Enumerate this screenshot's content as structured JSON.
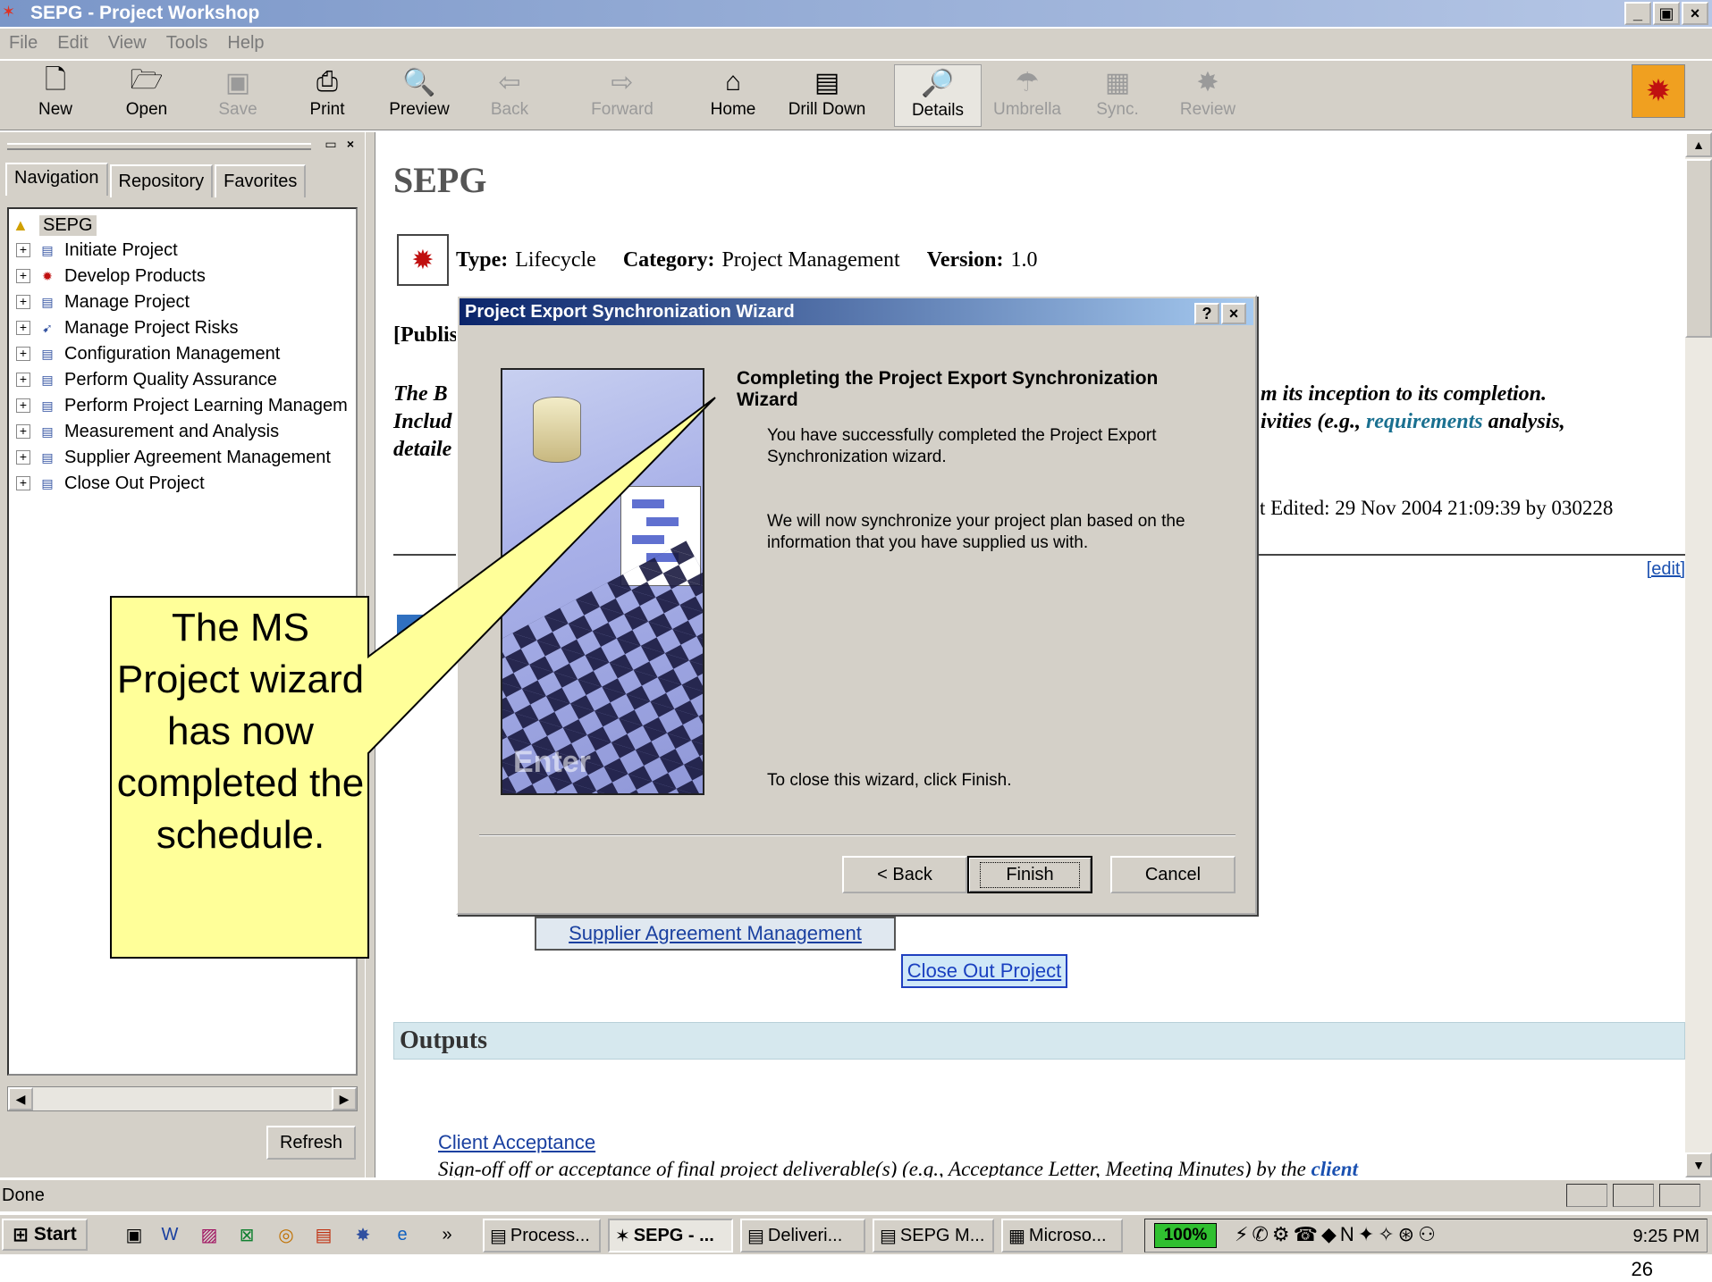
{
  "window": {
    "title": "SEPG - Project Workshop",
    "controls": [
      "_",
      "▣",
      "×"
    ]
  },
  "menu": [
    "File",
    "Edit",
    "View",
    "Tools",
    "Help"
  ],
  "toolbar": [
    {
      "label": "New",
      "icon": "new-document-icon",
      "enabled": true
    },
    {
      "label": "Open",
      "icon": "open-folder-icon",
      "enabled": true
    },
    {
      "label": "Save",
      "icon": "save-disk-icon",
      "enabled": false
    },
    {
      "label": "Print",
      "icon": "printer-icon",
      "enabled": true
    },
    {
      "label": "Preview",
      "icon": "print-preview-icon",
      "enabled": true
    },
    {
      "label": "Back",
      "icon": "back-arrow-icon",
      "enabled": false
    },
    {
      "label": "Forward",
      "icon": "forward-arrow-icon",
      "enabled": false
    },
    {
      "label": "Home",
      "icon": "home-icon",
      "enabled": true
    },
    {
      "label": "Drill Down",
      "icon": "drill-down-icon",
      "enabled": true
    },
    {
      "label": "Details",
      "icon": "magnifier-icon",
      "enabled": true
    },
    {
      "label": "Umbrella",
      "icon": "umbrella-icon",
      "enabled": false
    },
    {
      "label": "Sync.",
      "icon": "sync-grid-icon",
      "enabled": false
    },
    {
      "label": "Review",
      "icon": "review-icon",
      "enabled": false
    }
  ],
  "left_panel": {
    "tabs": [
      "Navigation",
      "Repository",
      "Favorites"
    ],
    "root": "SEPG",
    "tree": [
      "Initiate Project",
      "Develop Products",
      "Manage Project",
      "Manage Project Risks",
      "Configuration Management",
      "Perform Quality Assurance",
      "Perform Project Learning Managem",
      "Measurement and Analysis",
      "Supplier Agreement Management",
      "Close Out Project"
    ],
    "refresh": "Refresh"
  },
  "content": {
    "title": "SEPG",
    "type_label": "Type:",
    "type_value": "Lifecycle",
    "category_label": "Category:",
    "category_value": "Project Management",
    "version_label": "Version:",
    "version_value": "1.0",
    "published": "[Publis",
    "desc_left": [
      "The B",
      "Includ",
      "detaile"
    ],
    "desc_right_1": "m its inception to its completion.",
    "desc_right_2_pre": "ivities (e.g., ",
    "desc_right_2_link": "requirements",
    "desc_right_2_post": " analysis,",
    "last_edited": "st Edited: 29 Nov 2004 21:09:39 by 030228",
    "edit_link": "[edit]",
    "box_supplier": "Supplier Agreement Management",
    "box_closeout": "Close Out Project",
    "outputs_heading": "Outputs",
    "output_link": "Client Acceptance",
    "output_desc": "Sign-off off or acceptance of final project deliverable(s) (e.g., Acceptance Letter, Meeting Minutes) by the ",
    "output_desc_link": "client"
  },
  "dialog": {
    "title": "Project Export Synchronization Wizard",
    "help": "?",
    "close": "×",
    "heading": "Completing the Project Export Synchronization Wizard",
    "p1": "You have successfully completed the Project Export Synchronization wizard.",
    "p2": "We will now synchronize your project plan based on the information that you have supplied us with.",
    "p3": "To close this wizard, click Finish.",
    "art_text": "Enter",
    "back": "< Back",
    "finish": "Finish",
    "cancel": "Cancel"
  },
  "callout": {
    "text": "The MS Project wizard has now completed the schedule.",
    "fill": "#ffff99"
  },
  "status": "Done",
  "taskbar": {
    "start": "Start",
    "chevron": "»",
    "buttons": [
      "Process...",
      "SEPG - ...",
      "Deliveri...",
      "SEPG M...",
      "Microso..."
    ],
    "zoom": "100%",
    "clock": "9:25 PM"
  },
  "page_number": "26"
}
